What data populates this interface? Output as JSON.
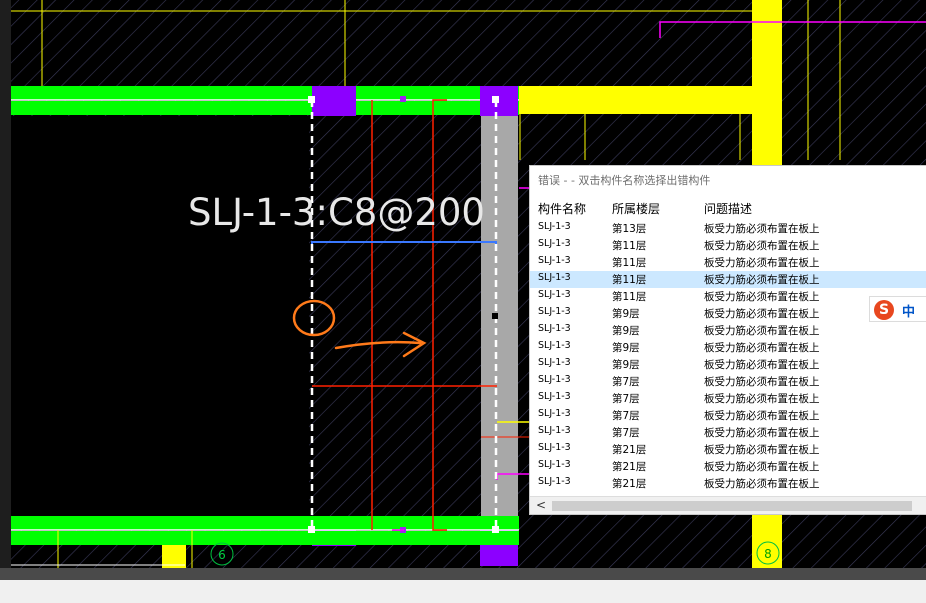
{
  "drawing": {
    "rebar_label": "SLJ-1-3:C8@200",
    "axis_6": "6",
    "axis_8": "8",
    "colors": {
      "background": "#000000",
      "beam_green": "#00ff00",
      "column_purple": "#8c00ff",
      "beam_yellow": "#ffff00",
      "hatch": "#2f2f4f",
      "rebar_red": "#ff2000",
      "rebar_blue": "#3a78ff",
      "annotation_orange": "#ff7a1a",
      "magenta": "#ff00ff"
    }
  },
  "error_window": {
    "title": "错误 - - 双击构件名称选择出错构件",
    "columns": [
      "构件名称",
      "所属楼层",
      "问题描述"
    ],
    "rows": [
      {
        "name": "SLJ-1-3",
        "floor": "第13层",
        "issue": "板受力筋必须布置在板上",
        "selected": false
      },
      {
        "name": "SLJ-1-3",
        "floor": "第11层",
        "issue": "板受力筋必须布置在板上",
        "selected": false
      },
      {
        "name": "SLJ-1-3",
        "floor": "第11层",
        "issue": "板受力筋必须布置在板上",
        "selected": false
      },
      {
        "name": "SLJ-1-3",
        "floor": "第11层",
        "issue": "板受力筋必须布置在板上",
        "selected": true
      },
      {
        "name": "SLJ-1-3",
        "floor": "第11层",
        "issue": "板受力筋必须布置在板上",
        "selected": false
      },
      {
        "name": "SLJ-1-3",
        "floor": "第9层",
        "issue": "板受力筋必须布置在板上",
        "selected": false
      },
      {
        "name": "SLJ-1-3",
        "floor": "第9层",
        "issue": "板受力筋必须布置在板上",
        "selected": false
      },
      {
        "name": "SLJ-1-3",
        "floor": "第9层",
        "issue": "板受力筋必须布置在板上",
        "selected": false
      },
      {
        "name": "SLJ-1-3",
        "floor": "第9层",
        "issue": "板受力筋必须布置在板上",
        "selected": false
      },
      {
        "name": "SLJ-1-3",
        "floor": "第7层",
        "issue": "板受力筋必须布置在板上",
        "selected": false
      },
      {
        "name": "SLJ-1-3",
        "floor": "第7层",
        "issue": "板受力筋必须布置在板上",
        "selected": false
      },
      {
        "name": "SLJ-1-3",
        "floor": "第7层",
        "issue": "板受力筋必须布置在板上",
        "selected": false
      },
      {
        "name": "SLJ-1-3",
        "floor": "第7层",
        "issue": "板受力筋必须布置在板上",
        "selected": false
      },
      {
        "name": "SLJ-1-3",
        "floor": "第21层",
        "issue": "板受力筋必须布置在板上",
        "selected": false
      },
      {
        "name": "SLJ-1-3",
        "floor": "第21层",
        "issue": "板受力筋必须布置在板上",
        "selected": false
      },
      {
        "name": "SLJ-1-3",
        "floor": "第21层",
        "issue": "板受力筋必须布置在板上",
        "selected": false
      }
    ],
    "scroll_left_arrow": "<"
  },
  "ime": {
    "logo_icon": "sogou-s-icon",
    "logo_char": "S",
    "mode": "中"
  }
}
